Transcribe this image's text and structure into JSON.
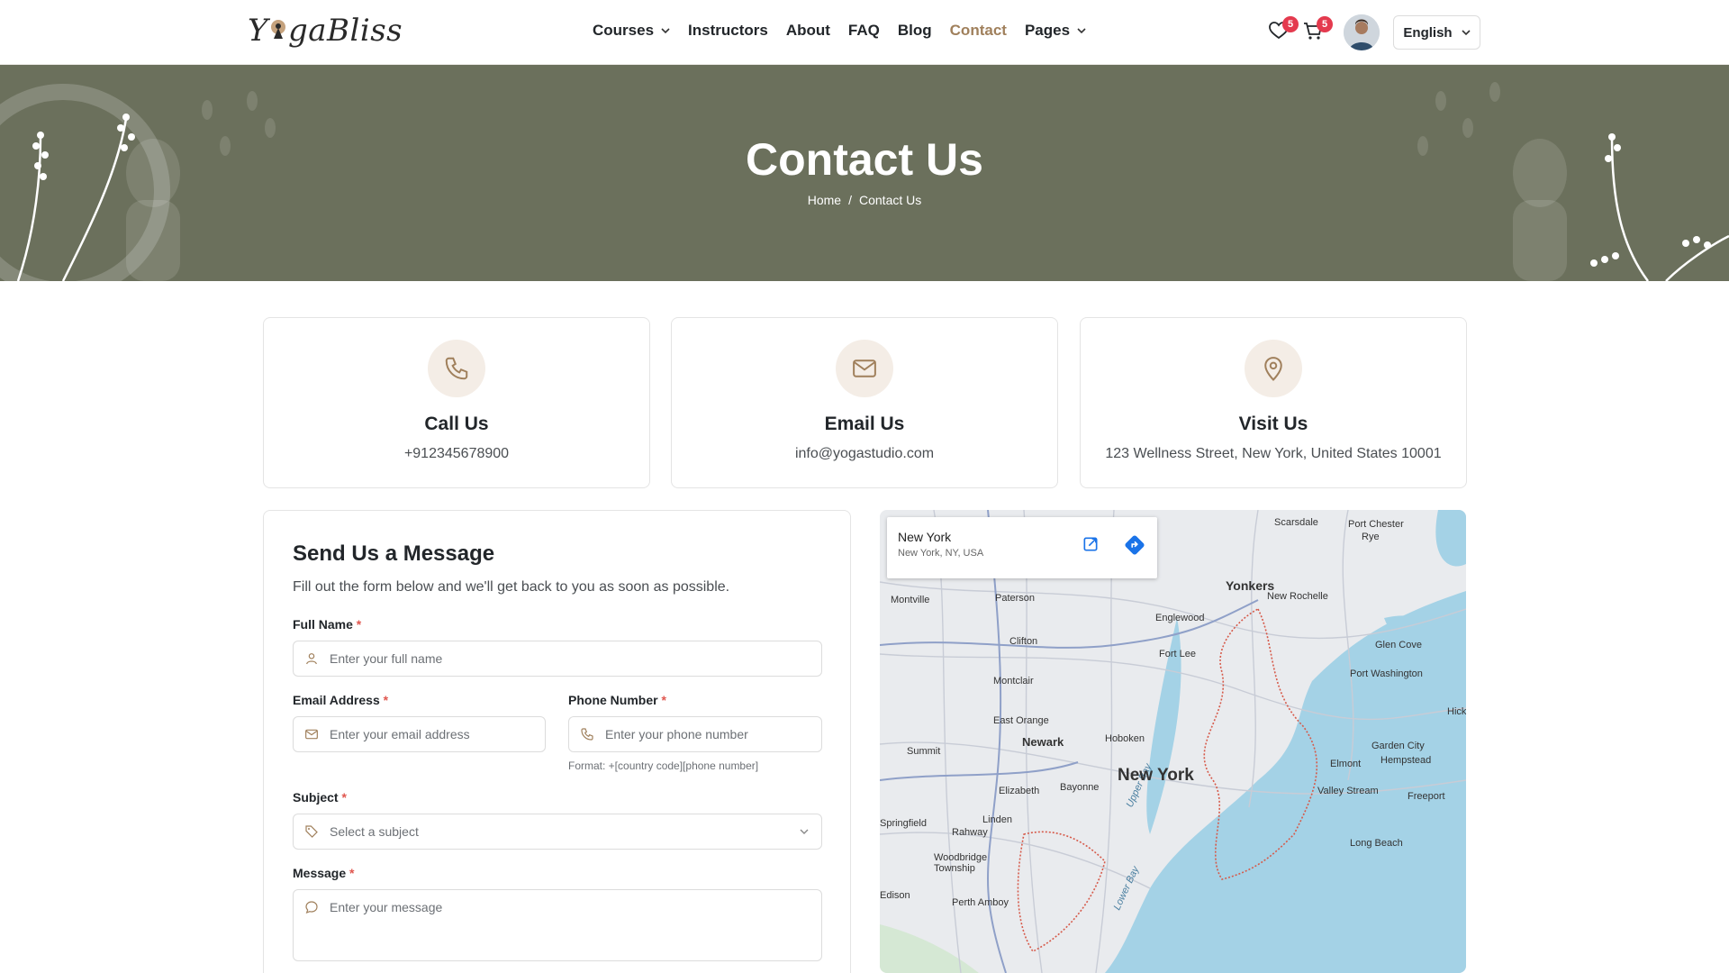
{
  "brand": {
    "logo_text_left": "Y",
    "logo_text_right": "gaBliss"
  },
  "nav": {
    "items": [
      {
        "label": "Courses",
        "dropdown": true,
        "active": false
      },
      {
        "label": "Instructors",
        "dropdown": false,
        "active": false
      },
      {
        "label": "About",
        "dropdown": false,
        "active": false
      },
      {
        "label": "FAQ",
        "dropdown": false,
        "active": false
      },
      {
        "label": "Blog",
        "dropdown": false,
        "active": false
      },
      {
        "label": "Contact",
        "dropdown": false,
        "active": true
      },
      {
        "label": "Pages",
        "dropdown": true,
        "active": false
      }
    ]
  },
  "header": {
    "wishlist_count": "5",
    "cart_count": "5",
    "language": "English"
  },
  "hero": {
    "title": "Contact Us",
    "breadcrumb_home": "Home",
    "breadcrumb_sep": "/",
    "breadcrumb_current": "Contact Us"
  },
  "cards": [
    {
      "icon": "phone-icon",
      "title": "Call Us",
      "text": "+912345678900"
    },
    {
      "icon": "mail-icon",
      "title": "Email Us",
      "text": "info@yogastudio.com"
    },
    {
      "icon": "location-pin-icon",
      "title": "Visit Us",
      "text": "123 Wellness Street, New York, United States 10001"
    }
  ],
  "form": {
    "title": "Send Us a Message",
    "subtitle": "Fill out the form below and we'll get back to you as soon as possible.",
    "full_name_label": "Full Name",
    "full_name_placeholder": "Enter your full name",
    "email_label": "Email Address",
    "email_placeholder": "Enter your email address",
    "phone_label": "Phone Number",
    "phone_placeholder": "Enter your phone number",
    "phone_hint": "Format: +[country code][phone number]",
    "subject_label": "Subject",
    "subject_placeholder": "Select a subject",
    "message_label": "Message",
    "message_placeholder": "Enter your message",
    "required_mark": "*"
  },
  "map": {
    "place_name": "New York",
    "place_address": "New York, NY, USA",
    "labels": [
      "Scarsdale",
      "Port Chester",
      "Rye",
      "Yonkers",
      "New Rochelle",
      "Montville",
      "Paterson",
      "Englewood",
      "Glen Cove",
      "Clifton",
      "Fort Lee",
      "Port Washington",
      "Montclair",
      "East Orange",
      "Hoboken",
      "Hicksville",
      "Summit",
      "Newark",
      "Garden City",
      "Hempstead",
      "Elmont",
      "Elizabeth",
      "Bayonne",
      "Valley Stream",
      "Freeport",
      "Linden",
      "Springfield",
      "Rahway",
      "Long Beach",
      "Woodbridge Township",
      "Edison",
      "Perth Amboy",
      "Upper Bay",
      "Lower Bay"
    ],
    "big_label": "New York"
  },
  "colors": {
    "accent": "#a0805c",
    "hero_bg": "#6b705c",
    "badge": "#e43a4e",
    "required": "#e0574f"
  }
}
